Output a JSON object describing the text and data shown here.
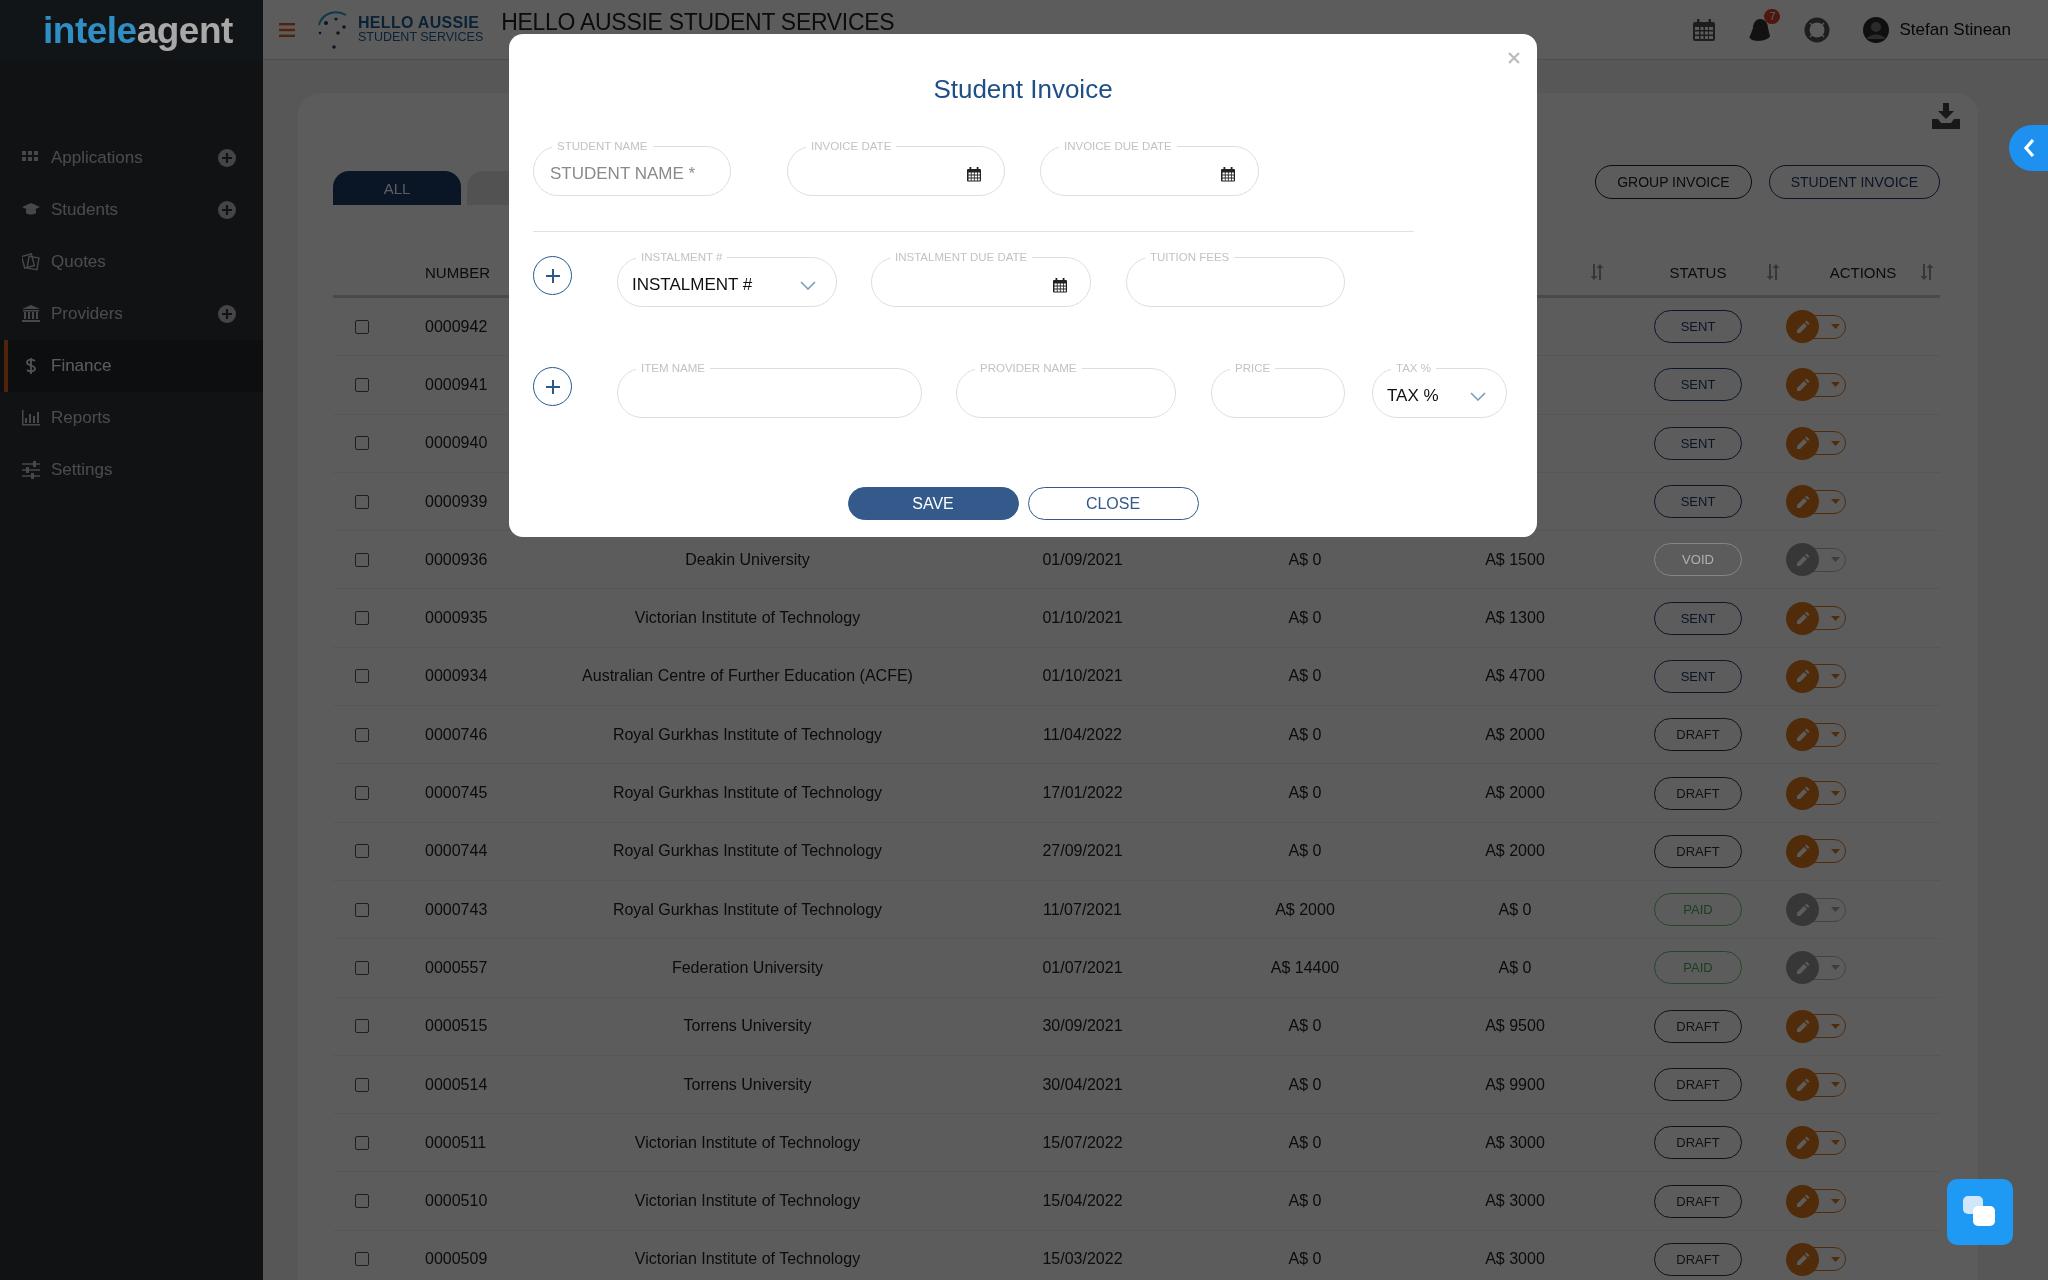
{
  "sidebar": {
    "logo": {
      "lead": "intele",
      "tail": "agent"
    },
    "items": [
      {
        "label": "Applications",
        "add": true,
        "selected": false
      },
      {
        "label": "Students",
        "add": true,
        "selected": false
      },
      {
        "label": "Quotes",
        "add": false,
        "selected": false
      },
      {
        "label": "Providers",
        "add": true,
        "selected": false
      },
      {
        "label": "Finance",
        "add": false,
        "selected": true
      },
      {
        "label": "Reports",
        "add": false,
        "selected": false
      },
      {
        "label": "Settings",
        "add": false,
        "selected": false
      }
    ]
  },
  "header": {
    "org_logo": {
      "line1": "HELLO AUSSIE",
      "line2": "STUDENT SERVICES"
    },
    "title": "HELLO AUSSIE STUDENT SERVICES",
    "notifications": "7",
    "user": "Stefan Stinean"
  },
  "toolbar": {
    "tabs": [
      {
        "label": "ALL",
        "selected": true
      },
      {
        "selected": false
      }
    ],
    "buttons": [
      {
        "label": "GROUP INVOICE",
        "kind": "default"
      },
      {
        "label": "STUDENT INVOICE",
        "kind": "primary"
      }
    ]
  },
  "table": {
    "columns": [
      {
        "label": "NUMBER",
        "sortable": false
      },
      {
        "label": "STATUS",
        "sortable": true
      },
      {
        "label": "ACTIONS",
        "sortable": true
      }
    ],
    "rows": [
      {
        "checked": false,
        "number": "0000942",
        "status": "SENT",
        "kind": "sent",
        "disabled": false
      },
      {
        "checked": false,
        "number": "0000941",
        "status": "SENT",
        "kind": "sent",
        "disabled": false
      },
      {
        "checked": false,
        "number": "0000940",
        "status": "SENT",
        "kind": "sent",
        "disabled": false
      },
      {
        "checked": false,
        "number": "0000939",
        "status": "SENT",
        "kind": "sent",
        "disabled": false
      },
      {
        "checked": false,
        "number": "0000936",
        "provider": "Deakin University",
        "date": "01/09/2021",
        "paid": "A$ 0",
        "due": "A$ 1500",
        "status": "VOID",
        "kind": "void",
        "disabled": true
      },
      {
        "checked": false,
        "number": "0000935",
        "provider": "Victorian Institute of Technology",
        "date": "01/10/2021",
        "paid": "A$ 0",
        "due": "A$ 1300",
        "status": "SENT",
        "kind": "sent",
        "disabled": false
      },
      {
        "checked": false,
        "number": "0000934",
        "provider": "Australian Centre of Further Education (ACFE)",
        "date": "01/10/2021",
        "paid": "A$ 0",
        "due": "A$ 4700",
        "status": "SENT",
        "kind": "sent",
        "disabled": false
      },
      {
        "checked": false,
        "number": "0000746",
        "provider": "Royal Gurkhas Institute of Technology",
        "date": "11/04/2022",
        "paid": "A$ 0",
        "due": "A$ 2000",
        "status": "DRAFT",
        "kind": "draft",
        "disabled": false
      },
      {
        "checked": false,
        "number": "0000745",
        "provider": "Royal Gurkhas Institute of Technology",
        "date": "17/01/2022",
        "paid": "A$ 0",
        "due": "A$ 2000",
        "status": "DRAFT",
        "kind": "draft",
        "disabled": false
      },
      {
        "checked": false,
        "number": "0000744",
        "provider": "Royal Gurkhas Institute of Technology",
        "date": "27/09/2021",
        "paid": "A$ 0",
        "due": "A$ 2000",
        "status": "DRAFT",
        "kind": "draft",
        "disabled": false
      },
      {
        "checked": false,
        "number": "0000743",
        "provider": "Royal Gurkhas Institute of Technology",
        "date": "11/07/2021",
        "paid": "A$ 2000",
        "due": "A$ 0",
        "status": "PAID",
        "kind": "paid",
        "disabled": true
      },
      {
        "checked": false,
        "number": "0000557",
        "provider": "Federation University",
        "date": "01/07/2021",
        "paid": "A$ 14400",
        "due": "A$ 0",
        "status": "PAID",
        "kind": "paid",
        "disabled": true
      },
      {
        "checked": false,
        "number": "0000515",
        "provider": "Torrens University",
        "date": "30/09/2021",
        "paid": "A$ 0",
        "due": "A$ 9500",
        "status": "DRAFT",
        "kind": "draft",
        "disabled": false
      },
      {
        "checked": false,
        "number": "0000514",
        "provider": "Torrens University",
        "date": "30/04/2021",
        "paid": "A$ 0",
        "due": "A$ 9900",
        "status": "DRAFT",
        "kind": "draft",
        "disabled": false
      },
      {
        "checked": false,
        "number": "0000511",
        "provider": "Victorian Institute of Technology",
        "date": "15/07/2022",
        "paid": "A$ 0",
        "due": "A$ 3000",
        "status": "DRAFT",
        "kind": "draft",
        "disabled": false
      },
      {
        "checked": false,
        "number": "0000510",
        "provider": "Victorian Institute of Technology",
        "date": "15/04/2022",
        "paid": "A$ 0",
        "due": "A$ 3000",
        "status": "DRAFT",
        "kind": "draft",
        "disabled": false
      },
      {
        "checked": false,
        "number": "0000509",
        "provider": "Victorian Institute of Technology",
        "date": "15/03/2022",
        "paid": "A$ 0",
        "due": "A$ 3000",
        "status": "DRAFT",
        "kind": "draft",
        "disabled": false
      }
    ]
  },
  "modal": {
    "title": "Student Invoice",
    "rows": [
      {
        "add": false,
        "fields": [
          {
            "kind": "text",
            "label": "STUDENT NAME",
            "placeholder": "STUDENT NAME *"
          },
          {
            "kind": "date",
            "label": "INVOICE DATE"
          },
          {
            "kind": "date",
            "label": "INVOICE DUE DATE"
          }
        ]
      },
      {
        "add": true,
        "fields": [
          {
            "kind": "select",
            "label": "INSTALMENT #",
            "value": "INSTALMENT #"
          },
          {
            "kind": "date",
            "label": "INSTALMENT DUE DATE"
          },
          {
            "kind": "text",
            "label": "TUITION FEES"
          }
        ]
      },
      {
        "add": true,
        "fields": [
          {
            "kind": "text",
            "label": "ITEM NAME"
          },
          {
            "kind": "text",
            "label": "PROVIDER NAME"
          },
          {
            "kind": "text",
            "label": "PRICE"
          },
          {
            "kind": "select",
            "label": "TAX %",
            "value": "TAX %"
          }
        ]
      }
    ],
    "buttons": [
      {
        "label": "SAVE",
        "kind": "primary"
      },
      {
        "label": "CLOSE",
        "kind": "secondary"
      }
    ]
  }
}
